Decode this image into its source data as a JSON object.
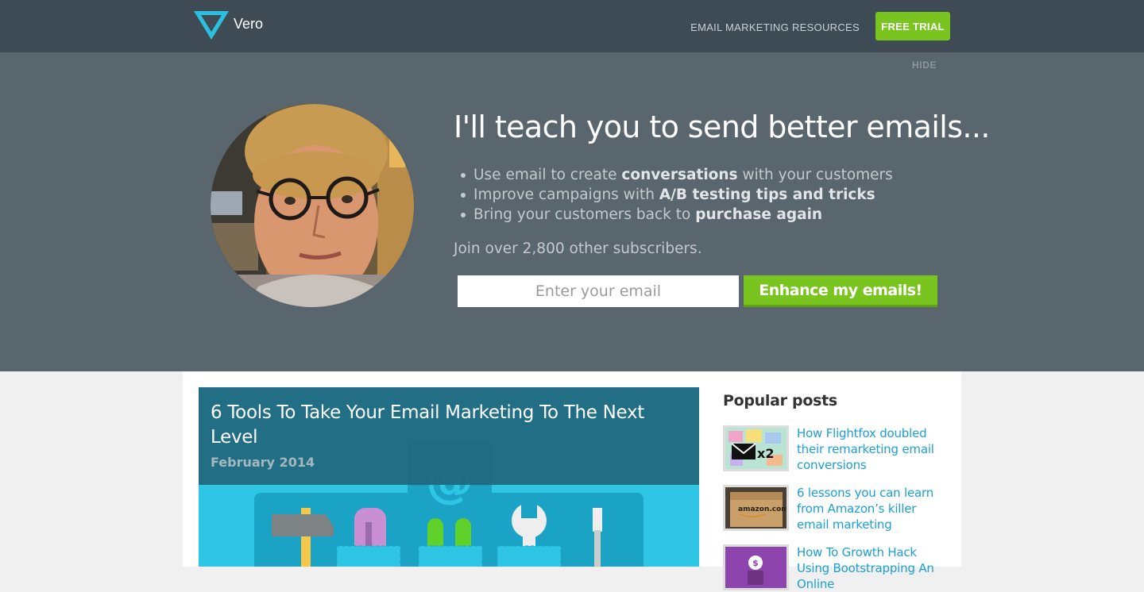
{
  "header": {
    "logo_text": "Vero",
    "nav_link": "EMAIL MARKETING RESOURCES",
    "trial_button": "FREE TRIAL"
  },
  "hero": {
    "hide_label": "HIDE",
    "title": "I'll teach you to send better emails...",
    "bullets": [
      {
        "before": "Use email to create ",
        "bold": "conversations",
        "after": " with your customers"
      },
      {
        "before": "Improve campaigns with ",
        "bold": "A/B testing tips and tricks",
        "after": ""
      },
      {
        "before": "Bring your customers back to ",
        "bold": "purchase again",
        "after": ""
      }
    ],
    "join_text": "Join over 2,800 other subscribers.",
    "email_placeholder": "Enter your email",
    "cta_button": "Enhance my emails!"
  },
  "feature_post": {
    "title": "6 Tools To Take Your Email Marketing To The Next Level",
    "date": "February 2014"
  },
  "sidebar": {
    "title": "Popular posts",
    "posts": [
      {
        "title": "How Flightfox doubled their remarketing email conversions",
        "thumb_text": "x2"
      },
      {
        "title": "6 lessons you can learn from Amazon’s killer email marketing",
        "thumb_text": "amazon.com"
      },
      {
        "title": "How To Growth Hack Using Bootstrapping An Online",
        "thumb_text": "$"
      }
    ]
  },
  "colors": {
    "header_bg": "#3f4b54",
    "hero_bg": "#5a666d",
    "brand_green": "#7ac41f",
    "link_blue": "#1a9fd6",
    "logo_cyan": "#2bbfe0"
  }
}
